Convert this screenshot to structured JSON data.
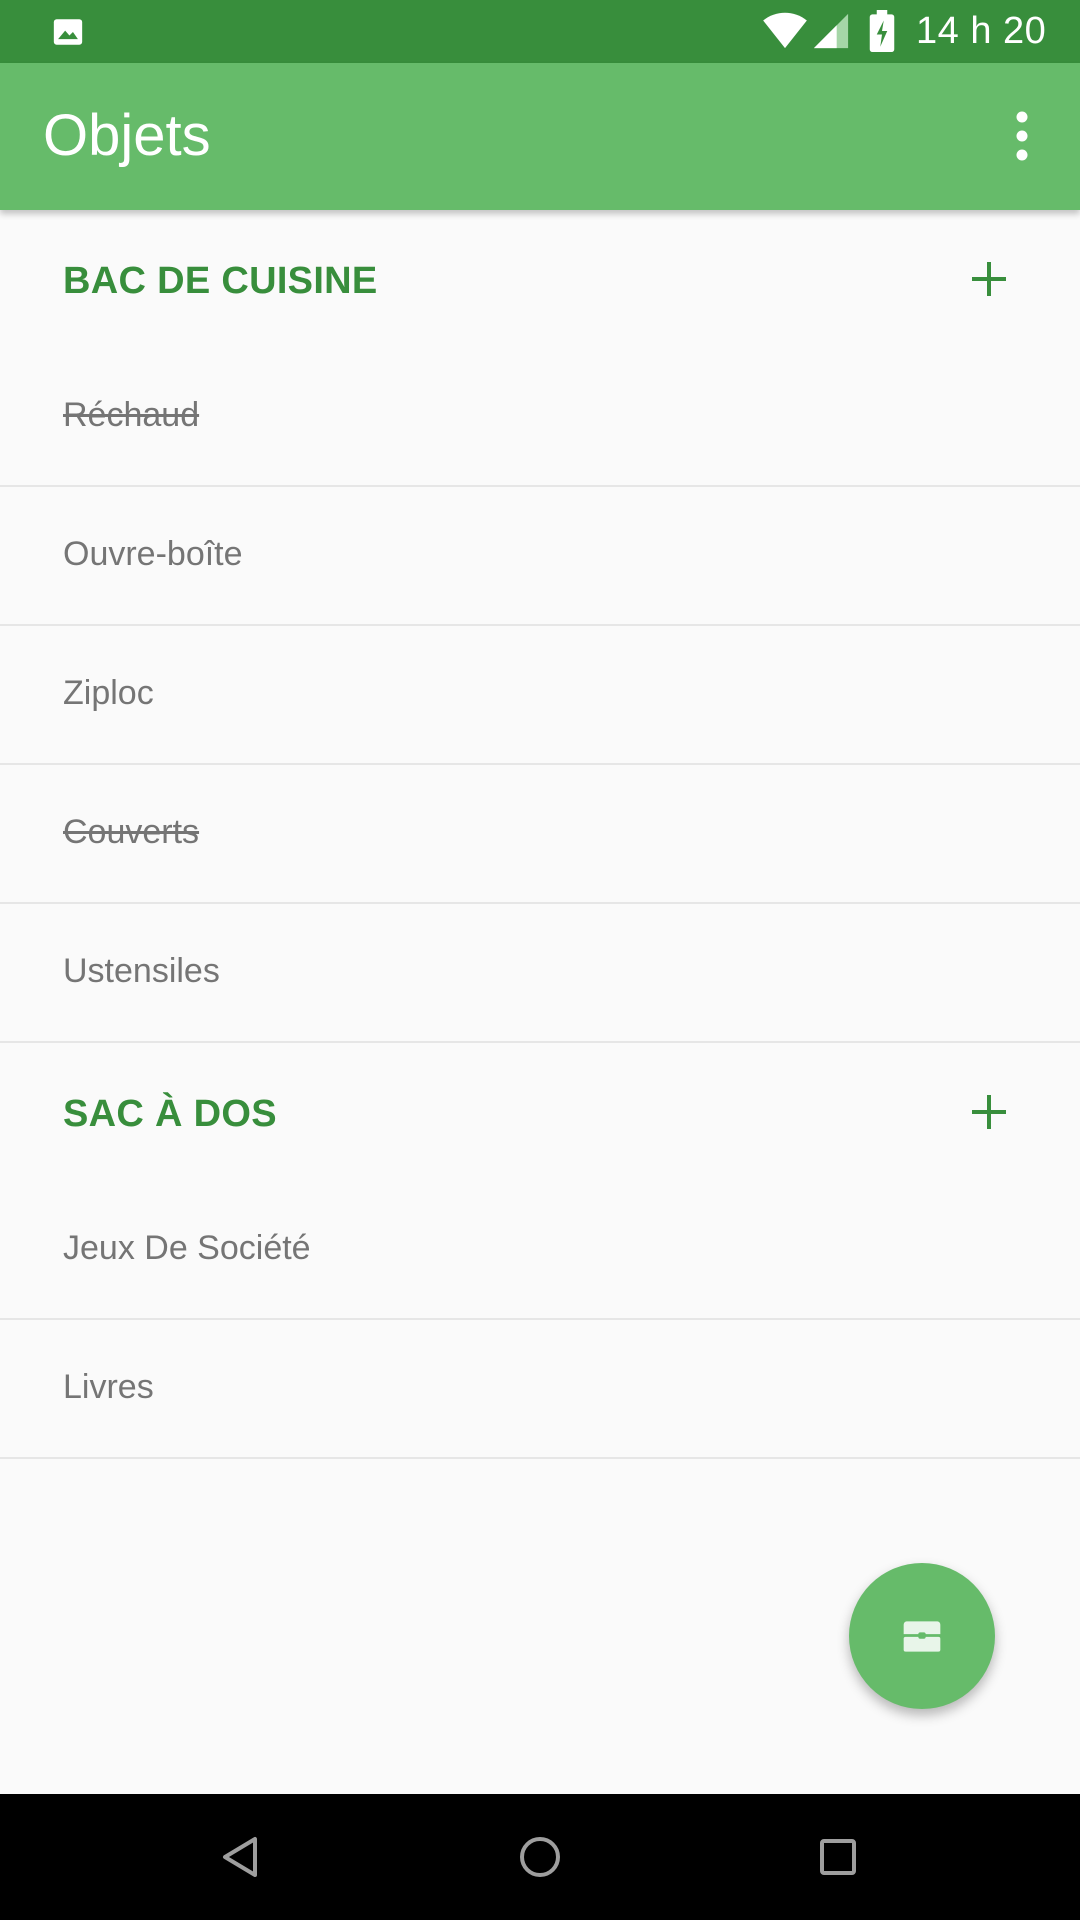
{
  "status_bar": {
    "time": "14 h 20",
    "left_icon": "image-notification-icon",
    "icons": [
      "wifi-icon",
      "signal-icon",
      "battery-charging-icon"
    ]
  },
  "app_bar": {
    "title": "Objets",
    "menu_icon": "more-vert-icon"
  },
  "sections": [
    {
      "title": "BAC DE CUISINE",
      "items": [
        {
          "label": "Réchaud",
          "checked": true
        },
        {
          "label": "Ouvre-boîte",
          "checked": false
        },
        {
          "label": "Ziploc",
          "checked": false
        },
        {
          "label": "Couverts",
          "checked": true
        },
        {
          "label": "Ustensiles",
          "checked": false
        }
      ]
    },
    {
      "title": "SAC À DOS",
      "items": [
        {
          "label": "Jeux De Société",
          "checked": false
        },
        {
          "label": "Livres",
          "checked": false
        }
      ]
    }
  ],
  "fab": {
    "icon": "storage-box-icon"
  },
  "nav_bar": {
    "icons": [
      "back-icon",
      "home-icon",
      "recents-icon"
    ]
  },
  "colors": {
    "status_bar": "#388e3c",
    "app_bar": "#66bb6a",
    "accent": "#388e3c",
    "fab": "#66bb6a",
    "item_text": "#757575",
    "background": "#fafafa"
  }
}
